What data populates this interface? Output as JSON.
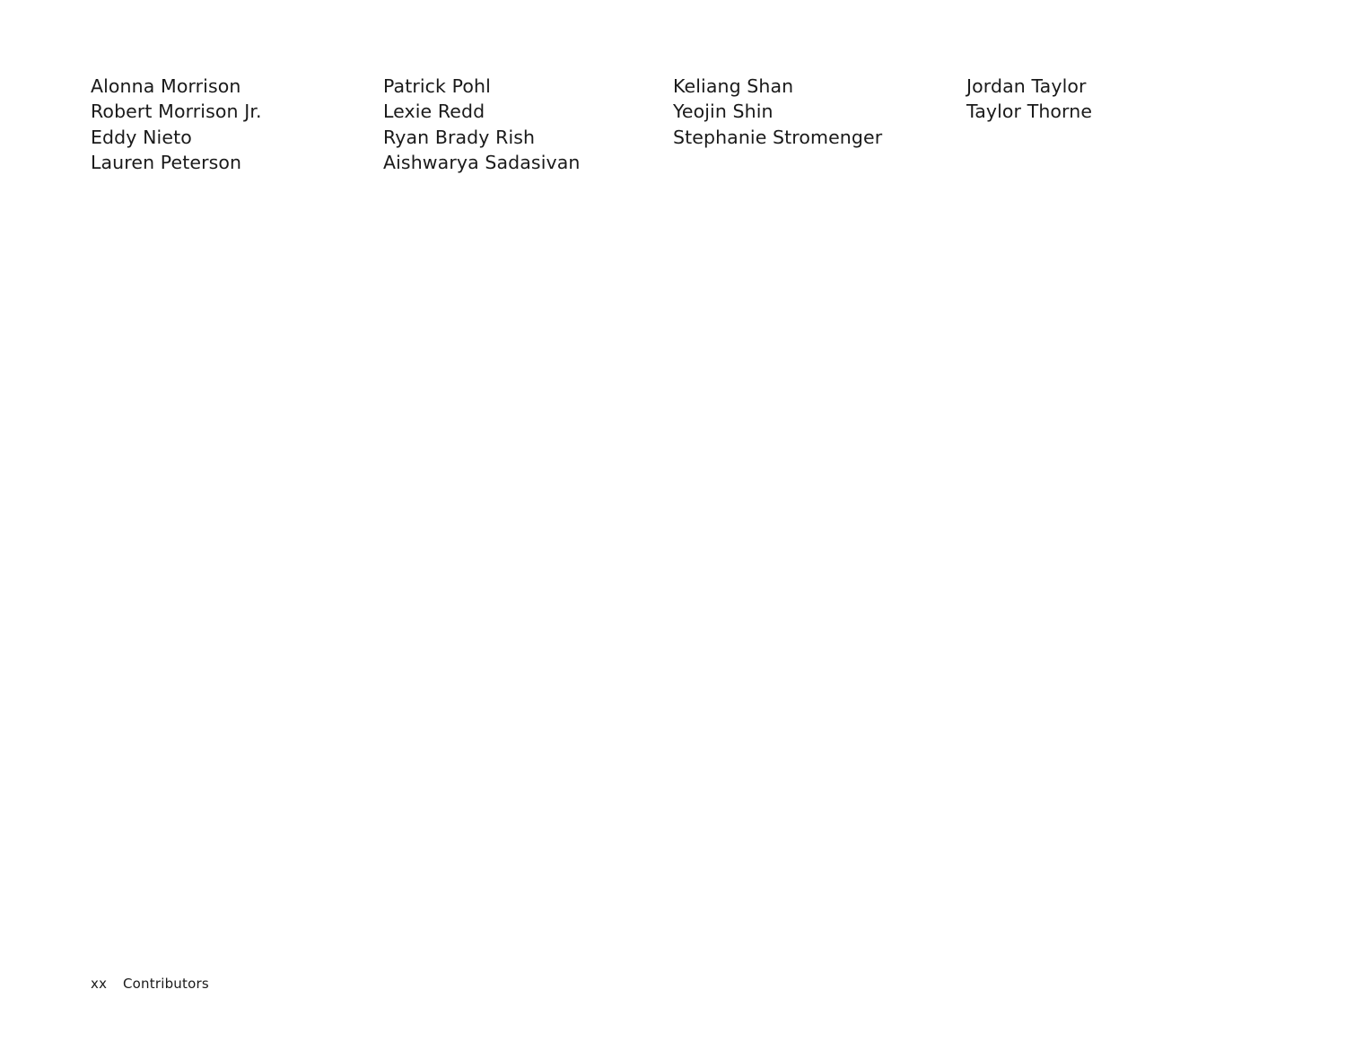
{
  "page": {
    "background_color": "#ffffff",
    "text_color": "#1a1a1a"
  },
  "contributors": {
    "columns": [
      {
        "names": [
          "Alonna Morrison",
          "Robert Morrison Jr.",
          "Eddy Nieto",
          "Lauren Peterson"
        ]
      },
      {
        "names": [
          "Patrick Pohl",
          "Lexie Redd",
          "Ryan Brady Rish",
          "Aishwarya Sadasivan"
        ]
      },
      {
        "names": [
          "Keliang Shan",
          "Yeojin Shin",
          "Stephanie Stromenger"
        ]
      },
      {
        "names": [
          "Jordan Taylor",
          "Taylor Thorne"
        ]
      }
    ]
  },
  "footer": {
    "folio": "xx",
    "section_title": "Contributors"
  }
}
